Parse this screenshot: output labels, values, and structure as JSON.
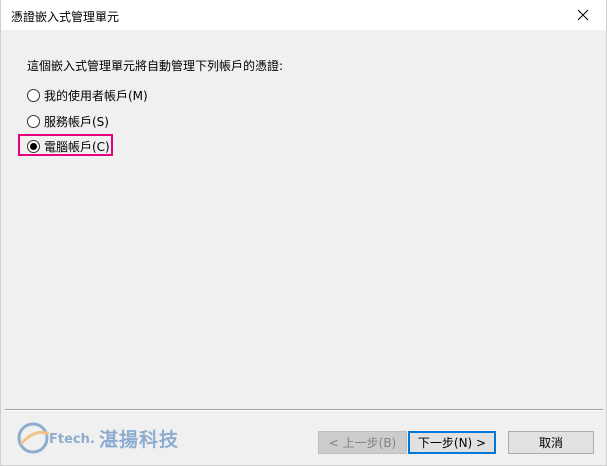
{
  "window": {
    "title": "憑證嵌入式管理單元"
  },
  "instruction": "這個嵌入式管理單元將自動管理下列帳戶的憑證:",
  "options": [
    {
      "label": "我的使用者帳戶(M)",
      "checked": false
    },
    {
      "label": "服務帳戶(S)",
      "checked": false
    },
    {
      "label": "電腦帳戶(C)",
      "checked": true
    }
  ],
  "buttons": {
    "back": "< 上一步(B)",
    "next": "下一步(N) >",
    "cancel": "取消"
  },
  "watermark": {
    "brand": "Ftech.",
    "text": "湛揚科技"
  },
  "colors": {
    "highlight": "#e4007f",
    "primary_border": "#0078d7",
    "watermark": "#3b76b6"
  }
}
